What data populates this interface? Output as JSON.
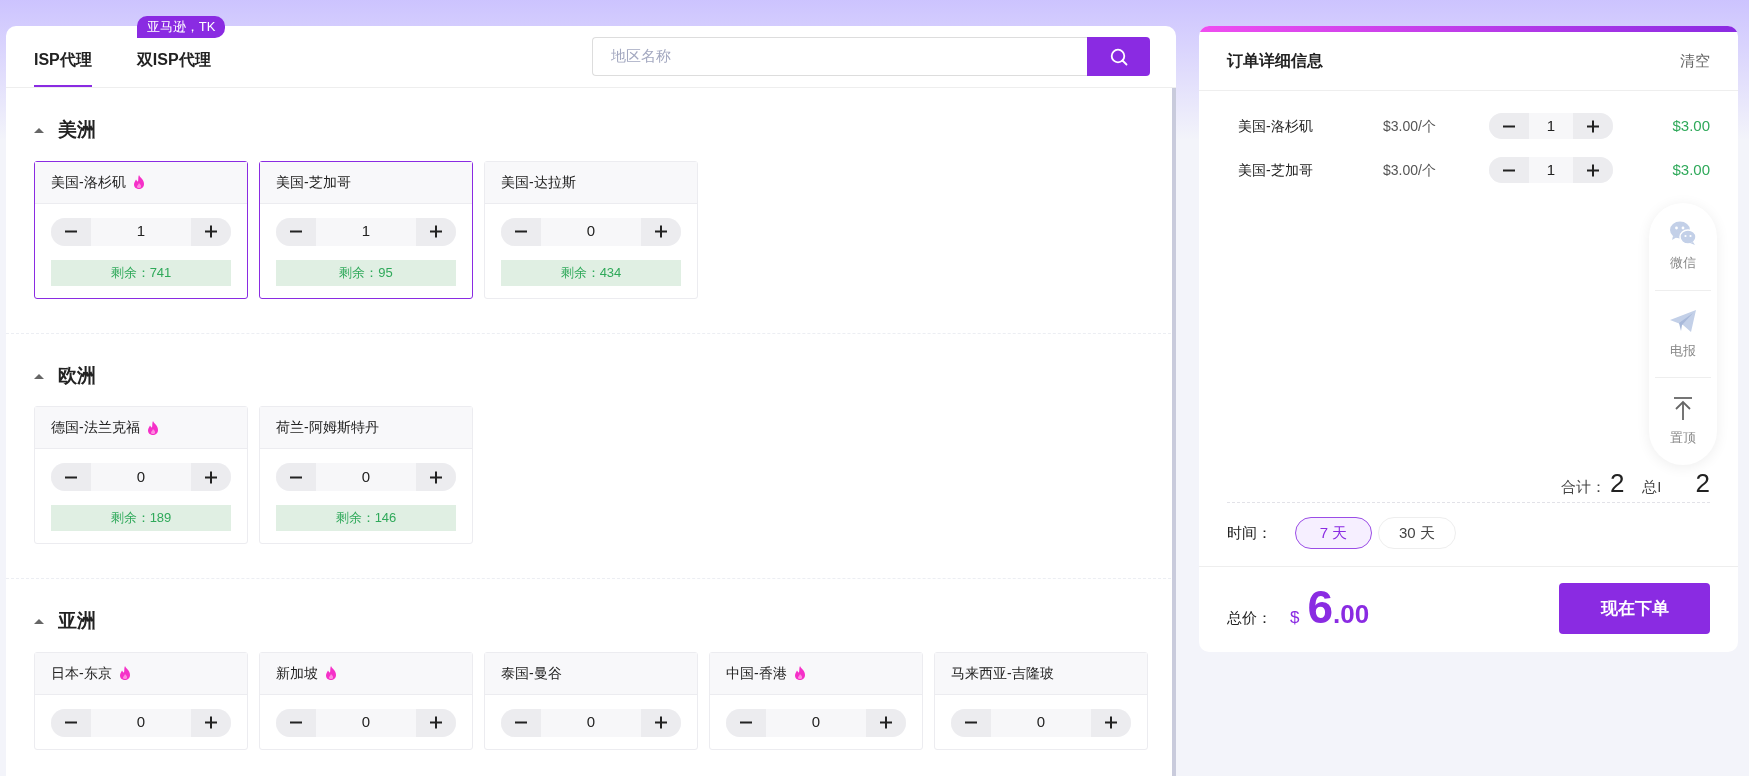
{
  "tabs": [
    {
      "label": "ISP代理",
      "selected": true
    },
    {
      "label": "双ISP代理",
      "selected": false,
      "badge": "亚马逊，TK"
    }
  ],
  "search": {
    "placeholder": "地区名称"
  },
  "regions": [
    {
      "name": "美洲",
      "expanded": true,
      "cities": [
        {
          "name": "美国-洛杉矶",
          "hot": true,
          "selected": true,
          "quantity": "1",
          "remaining": "剩余：741"
        },
        {
          "name": "美国-芝加哥",
          "hot": false,
          "selected": true,
          "quantity": "1",
          "remaining": "剩余：95"
        },
        {
          "name": "美国-达拉斯",
          "hot": false,
          "selected": false,
          "quantity": "0",
          "remaining": "剩余：434"
        }
      ]
    },
    {
      "name": "欧洲",
      "expanded": true,
      "cities": [
        {
          "name": "德国-法兰克福",
          "hot": true,
          "selected": false,
          "quantity": "0",
          "remaining": "剩余：189"
        },
        {
          "name": "荷兰-阿姆斯特丹",
          "hot": false,
          "selected": false,
          "quantity": "0",
          "remaining": "剩余：146"
        }
      ]
    },
    {
      "name": "亚洲",
      "expanded": true,
      "cities": [
        {
          "name": "日本-东京",
          "hot": true,
          "selected": false,
          "quantity": "0"
        },
        {
          "name": "新加坡",
          "hot": true,
          "selected": false,
          "quantity": "0"
        },
        {
          "name": "泰国-曼谷",
          "hot": false,
          "selected": false,
          "quantity": "0"
        },
        {
          "name": "中国-香港",
          "hot": true,
          "selected": false,
          "quantity": "0"
        },
        {
          "name": "马来西亚-吉隆玻",
          "hot": false,
          "selected": false,
          "quantity": "0"
        }
      ]
    }
  ],
  "order": {
    "title": "订单详细信息",
    "clear": "清空",
    "items": [
      {
        "name": "美国-洛杉矶",
        "price": "$3.00/个",
        "quantity": "1",
        "subtotal": "$3.00"
      },
      {
        "name": "美国-芝加哥",
        "price": "$3.00/个",
        "quantity": "1",
        "subtotal": "$3.00"
      }
    ],
    "total_count_label": "合计：",
    "total_count": "2",
    "total_ip_label": "总I",
    "total_ip": "2",
    "time_label": "时间：",
    "durations": [
      {
        "label": "7 天",
        "selected": true
      },
      {
        "label": "30 天",
        "selected": false
      }
    ],
    "price_label": "总价：",
    "currency": "$",
    "price_int": "6",
    "price_dec": ".00",
    "submit": "现在下单"
  },
  "float_bar": [
    {
      "kind": "wechat",
      "label": "微信"
    },
    {
      "kind": "telegram",
      "label": "电报"
    },
    {
      "kind": "top",
      "label": "置顶"
    }
  ]
}
